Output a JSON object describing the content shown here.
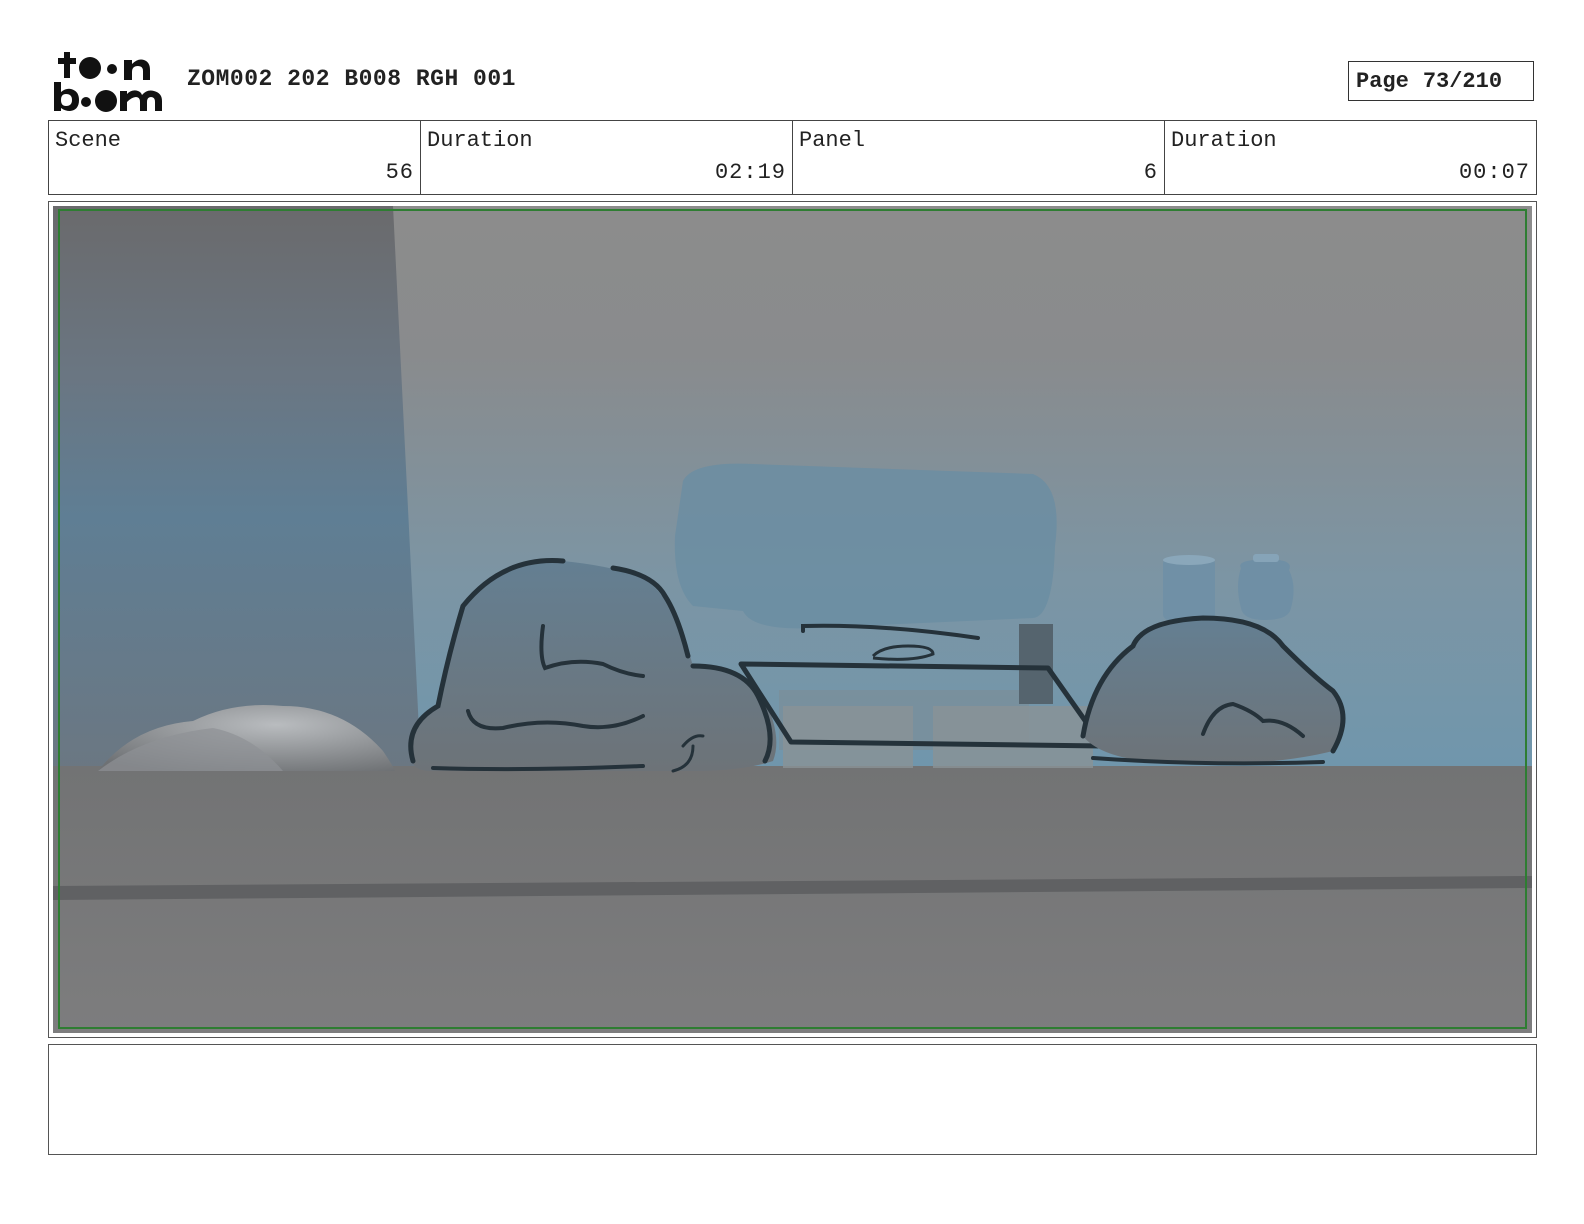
{
  "header": {
    "logo_text": "toon boom",
    "title": "ZOM002 202 B008 RGH 001",
    "page_label": "Page",
    "page_value": "73/210"
  },
  "info": {
    "scene_label": "Scene",
    "scene_value": "56",
    "duration_label": "Duration",
    "duration_value": "02:19",
    "panel_label": "Panel",
    "panel_value": "6",
    "panel_duration_label": "Duration",
    "panel_duration_value": "00:07"
  },
  "notes": {
    "text": ""
  },
  "colors": {
    "frame_green": "#2e7d32",
    "sky_blue": "#6f96ad",
    "floor_gray": "#7b7b7d",
    "sketch_line": "#25323a"
  }
}
